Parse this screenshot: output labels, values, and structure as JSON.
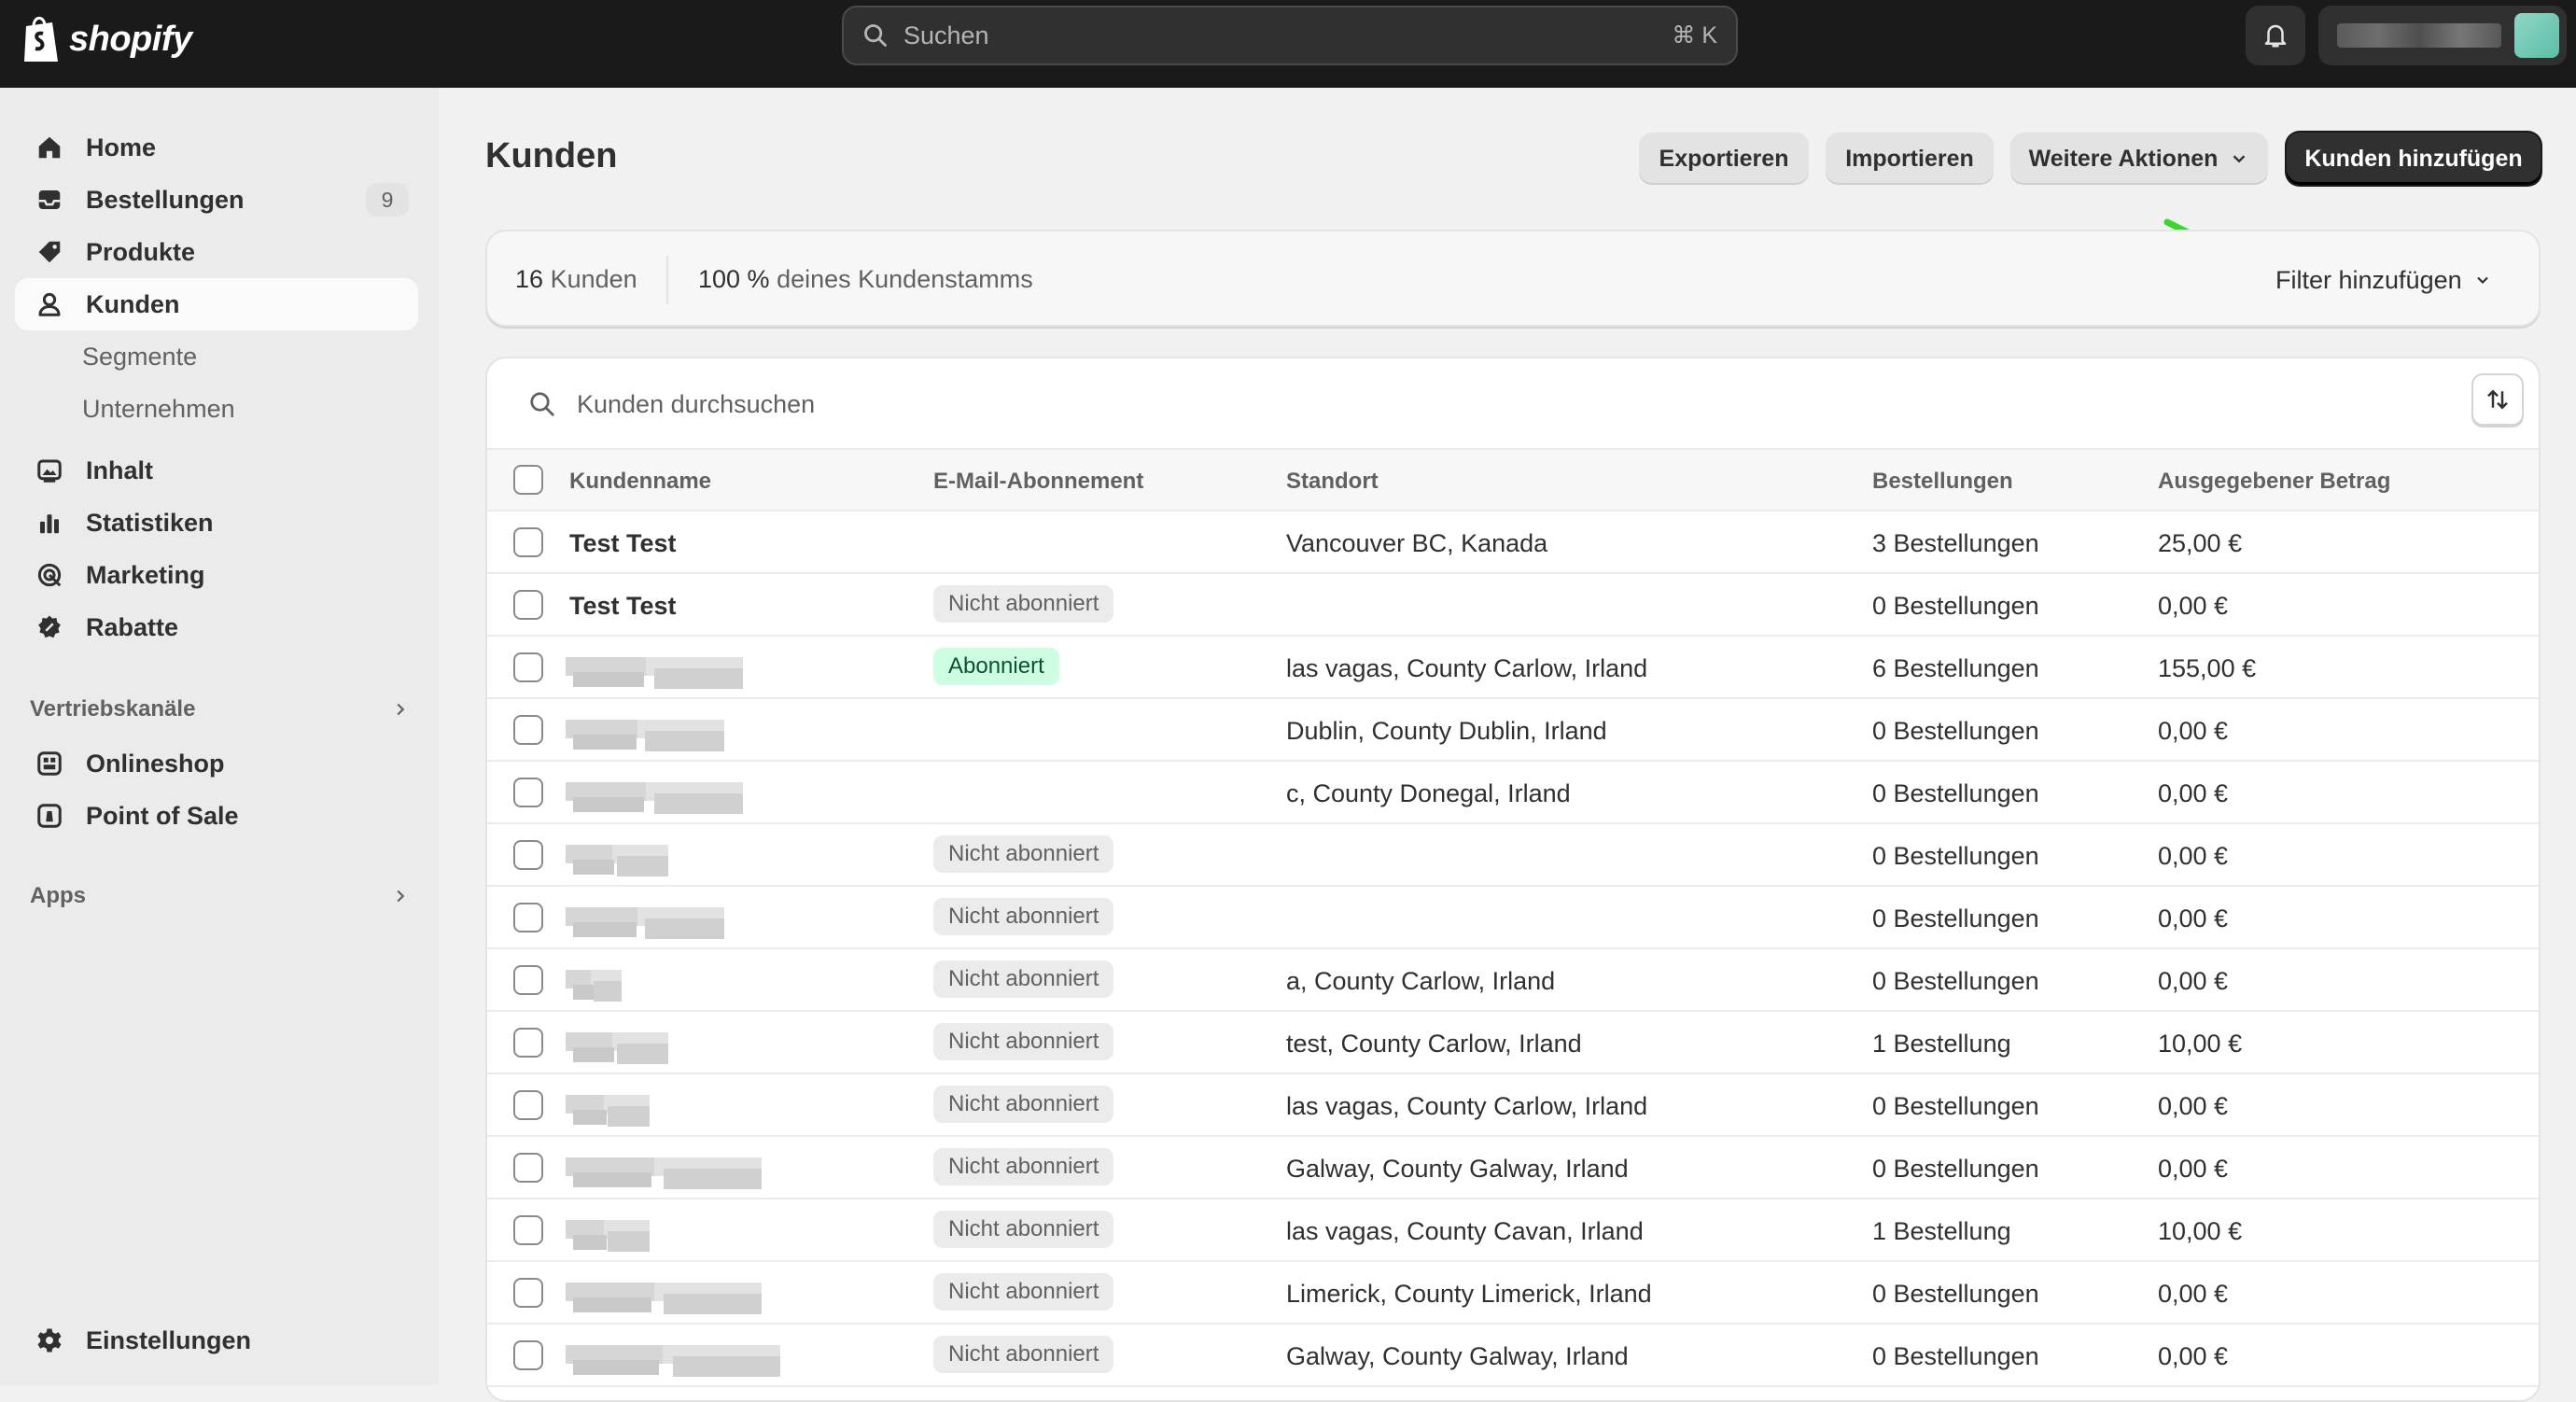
{
  "topbar": {
    "brand": "shopify",
    "search_placeholder": "Suchen",
    "search_shortcut": "⌘ K"
  },
  "sidebar": {
    "items": [
      {
        "label": "Home",
        "icon": "home-icon"
      },
      {
        "label": "Bestellungen",
        "icon": "inbox-icon",
        "badge": "9"
      },
      {
        "label": "Produkte",
        "icon": "tag-icon"
      },
      {
        "label": "Kunden",
        "icon": "person-icon",
        "active": true
      },
      {
        "label": "Segmente",
        "sub": true
      },
      {
        "label": "Unternehmen",
        "sub": true
      },
      {
        "label": "Inhalt",
        "icon": "image-icon"
      },
      {
        "label": "Statistiken",
        "icon": "bar-chart-icon"
      },
      {
        "label": "Marketing",
        "icon": "target-icon"
      },
      {
        "label": "Rabatte",
        "icon": "discount-icon"
      }
    ],
    "sales_channels_label": "Vertriebskanäle",
    "channels": [
      {
        "label": "Onlineshop",
        "icon": "store-icon"
      },
      {
        "label": "Point of Sale",
        "icon": "pos-icon"
      }
    ],
    "apps_label": "Apps",
    "settings_label": "Einstellungen"
  },
  "main": {
    "title": "Kunden",
    "buttons": {
      "export": "Exportieren",
      "import": "Importieren",
      "more": "Weitere Aktionen",
      "add": "Kunden hinzufügen"
    },
    "summary": {
      "count_number": "16",
      "count_label": "Kunden",
      "pct_number": "100 %",
      "pct_label": "deines Kundenstamms",
      "filter_label": "Filter hinzufügen"
    },
    "table": {
      "search_placeholder": "Kunden durchsuchen",
      "columns": [
        "Kundenname",
        "E-Mail-Abonnement",
        "Standort",
        "Bestellungen",
        "Ausgegebener Betrag"
      ],
      "rows": [
        {
          "name": "Test Test",
          "email": "",
          "location": "Vancouver BC, Kanada",
          "orders": "3 Bestellungen",
          "amount": "25,00 €"
        },
        {
          "name": "Test Test",
          "email": "Nicht abonniert",
          "location": "",
          "orders": "0 Bestellungen",
          "amount": "0,00 €"
        },
        {
          "name": "",
          "email": "Abonniert",
          "location": "las vagas, County Carlow, Irland",
          "orders": "6 Bestellungen",
          "amount": "155,00 €"
        },
        {
          "name": "",
          "email": "",
          "location": "Dublin, County Dublin, Irland",
          "orders": "0 Bestellungen",
          "amount": "0,00 €"
        },
        {
          "name": "",
          "email": "",
          "location": "c, County Donegal, Irland",
          "orders": "0 Bestellungen",
          "amount": "0,00 €"
        },
        {
          "name": "",
          "email": "Nicht abonniert",
          "location": "",
          "orders": "0 Bestellungen",
          "amount": "0,00 €"
        },
        {
          "name": "",
          "email": "Nicht abonniert",
          "location": "",
          "orders": "0 Bestellungen",
          "amount": "0,00 €"
        },
        {
          "name": "",
          "email": "Nicht abonniert",
          "location": "a, County Carlow, Irland",
          "orders": "0 Bestellungen",
          "amount": "0,00 €"
        },
        {
          "name": "",
          "email": "Nicht abonniert",
          "location": "test, County Carlow, Irland",
          "orders": "1 Bestellung",
          "amount": "10,00 €"
        },
        {
          "name": "",
          "email": "Nicht abonniert",
          "location": "las vagas, County Carlow, Irland",
          "orders": "0 Bestellungen",
          "amount": "0,00 €"
        },
        {
          "name": "",
          "email": "Nicht abonniert",
          "location": "Galway, County Galway, Irland",
          "orders": "0 Bestellungen",
          "amount": "0,00 €"
        },
        {
          "name": "",
          "email": "Nicht abonniert",
          "location": "las vagas, County Cavan, Irland",
          "orders": "1 Bestellung",
          "amount": "10,00 €"
        },
        {
          "name": "",
          "email": "Nicht abonniert",
          "location": "Limerick, County Limerick, Irland",
          "orders": "0 Bestellungen",
          "amount": "0,00 €"
        },
        {
          "name": "",
          "email": "Nicht abonniert",
          "location": "Galway, County Galway, Irland",
          "orders": "0 Bestellungen",
          "amount": "0,00 €"
        }
      ]
    }
  },
  "colors": {
    "topbar": "#1a1a1a",
    "sidebar": "#ebebeb",
    "subscribed_badge": "#cdfee1",
    "annotation_arrow": "#36d82a"
  }
}
